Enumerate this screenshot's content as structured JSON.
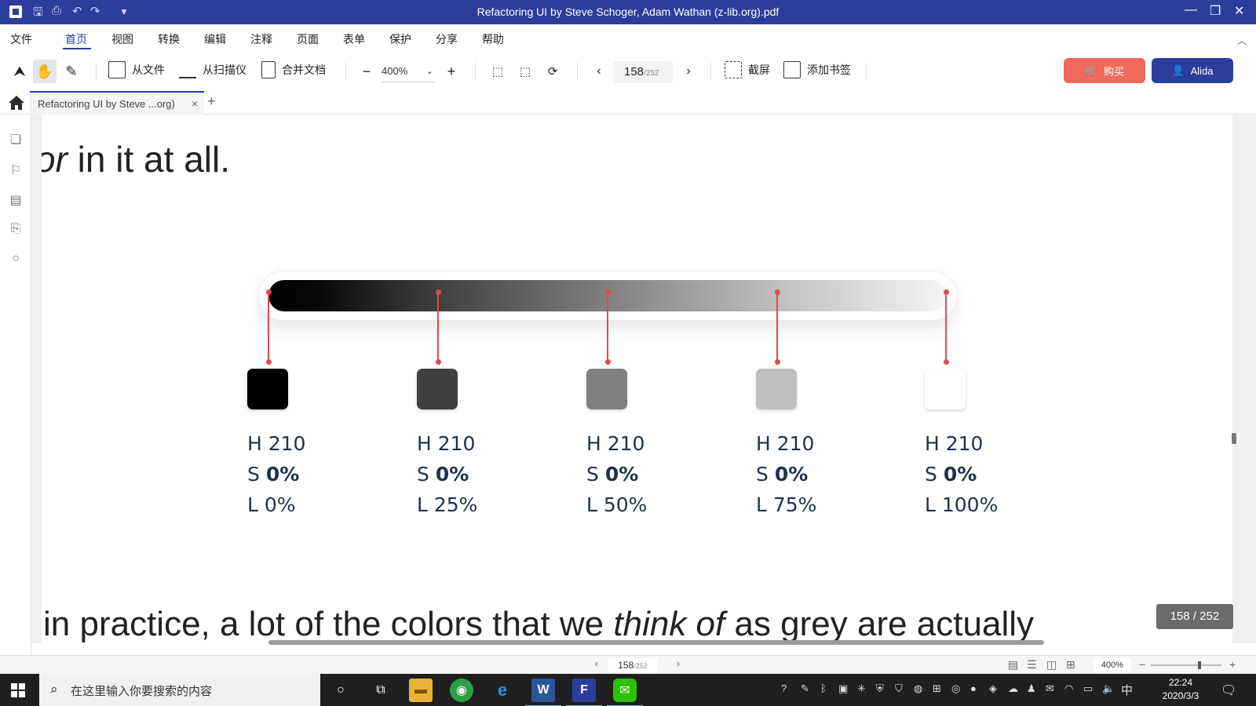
{
  "window": {
    "title": "Refactoring UI by Steve Schoger, Adam Wathan (z-lib.org).pdf",
    "accent": "#2c3e9c"
  },
  "menu": [
    "文件",
    "首页",
    "视图",
    "转换",
    "编辑",
    "注释",
    "页面",
    "表单",
    "保护",
    "分享",
    "帮助"
  ],
  "toolbar": {
    "from_file": "从文件",
    "from_scanner": "从扫描仪",
    "merge_docs": "合并文档",
    "zoom_value": "400%",
    "zoom_minus": "−",
    "zoom_plus": "+",
    "page_current": "158",
    "page_total": "/252",
    "screenshot": "截屏",
    "add_bookmark": "添加书签",
    "buy": "购买",
    "user": "Alida",
    "buy_color": "#f06a5d"
  },
  "tab": {
    "label": "Refactoring UI by Steve ...org)",
    "close": "×",
    "add": "+"
  },
  "document": {
    "top_text_start": "or",
    "top_text_rest": " in it at all.",
    "bottom_text_1": "in practice, a lot of the colors that we ",
    "bottom_text_em": "think of",
    "bottom_text_2": " as grey are actually",
    "swatches": [
      {
        "h": "H 210",
        "s_prefix": "S ",
        "s": "0%",
        "l": "L 0%",
        "color": "#000000"
      },
      {
        "h": "H 210",
        "s_prefix": "S ",
        "s": "0%",
        "l": "L 25%",
        "color": "#404040"
      },
      {
        "h": "H 210",
        "s_prefix": "S ",
        "s": "0%",
        "l": "L 50%",
        "color": "#808080"
      },
      {
        "h": "H 210",
        "s_prefix": "S ",
        "s": "0%",
        "l": "L 75%",
        "color": "#bfbfbf"
      },
      {
        "h": "H 210",
        "s_prefix": "S ",
        "s": "0%",
        "l": "L 100%",
        "color": "#ffffff"
      }
    ],
    "connector_color": "#e34a4a",
    "page_indicator": "158 / 252"
  },
  "statusbar": {
    "page_current": "158",
    "page_total": "/252",
    "zoom": "400%",
    "prev": "‹",
    "next": "›",
    "minus": "−",
    "plus": "+"
  },
  "taskbar": {
    "search_placeholder": "在这里输入你要搜索的内容",
    "ime": "中",
    "time": "22:24",
    "date": "2020/3/3"
  }
}
